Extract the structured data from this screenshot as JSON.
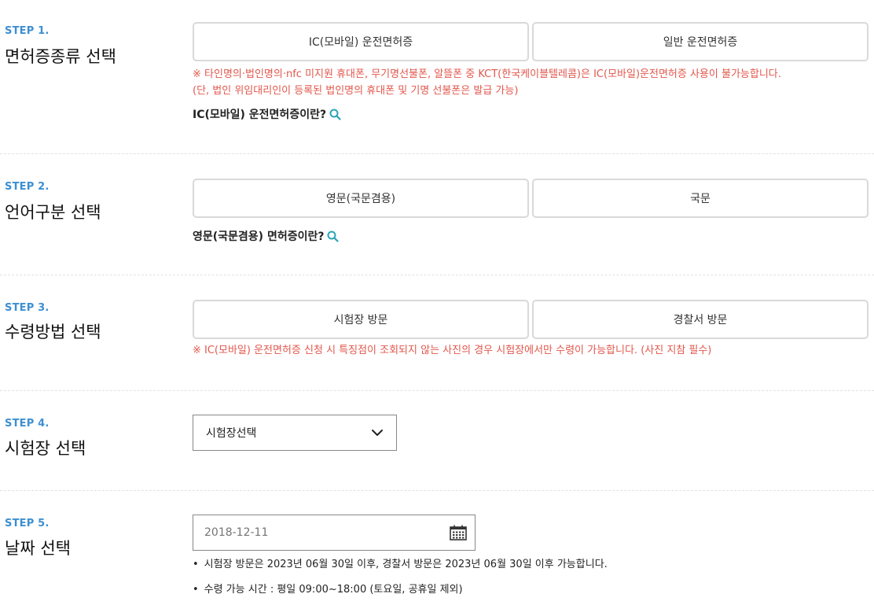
{
  "steps": [
    {
      "num": "STEP 1.",
      "title": "면허증종류 선택",
      "options": [
        "IC(모바일) 운전면허증",
        "일반 운전면허증"
      ],
      "notes": [
        "※ 타인명의·법인명의·nfc 미지원 휴대폰, 무기명선불폰, 알뜰폰 중 KCT(한국케이블텔레콤)은 IC(모바일)운전면허증 사용이 불가능합니다.",
        "(단, 법인 위임대리인이 등록된 법인명의 휴대폰 및 기명 선불폰은 발급 가능)"
      ],
      "info_link": "IC(모바일) 운전면허증이란?"
    },
    {
      "num": "STEP 2.",
      "title": "언어구분 선택",
      "options": [
        "영문(국문겸용)",
        "국문"
      ],
      "info_link": "영문(국문겸용) 면허증이란?"
    },
    {
      "num": "STEP 3.",
      "title": "수령방법 선택",
      "options": [
        "시험장 방문",
        "경찰서 방문"
      ],
      "notes": [
        "※ IC(모바일) 운전면허증 신청 시 특징점이 조회되지 않는 사진의 경우 시험장에서만 수령이 가능합니다. (사진 지참 필수)"
      ]
    },
    {
      "num": "STEP 4.",
      "title": "시험장 선택",
      "select_value": "시험장선택"
    },
    {
      "num": "STEP 5.",
      "title": "날짜 선택",
      "date_placeholder": "2018-12-11",
      "bullets": [
        "시험장 방문은 2023년 06월 30일 이후, 경찰서 방문은 2023년 06월 30일 이후 가능합니다.",
        "수령 가능 시간 : 평일 09:00~18:00 (토요일, 공휴일 제외)"
      ]
    }
  ],
  "icons": {
    "info": "search-icon",
    "select": "chevron-down-icon",
    "date": "calendar-icon"
  },
  "colors": {
    "step_label": "#3d8fd1",
    "note": "#e2574c",
    "search_icon": "#2aa5b8"
  }
}
